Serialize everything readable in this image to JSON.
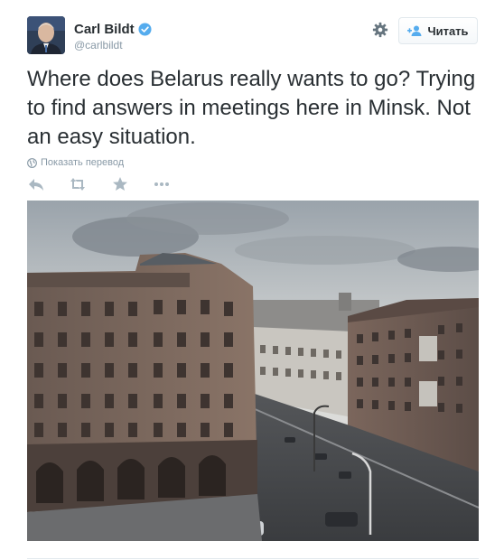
{
  "tweet": {
    "author_name": "Carl Bildt",
    "handle": "@carlbildt",
    "text": "Where does Belarus really wants to go? Trying to find answers in meetings here in Minsk. Not an easy situation.",
    "translate_label": "Показать перевод"
  },
  "header": {
    "follow_label": "Читать"
  },
  "icons": {
    "verified": "verified-badge-icon",
    "settings": "gear-icon",
    "follow": "add-user-icon",
    "translate": "globe-icon",
    "reply": "reply-icon",
    "retweet": "retweet-icon",
    "favorite": "star-icon",
    "more": "more-icon"
  },
  "colors": {
    "verified_blue": "#55acee",
    "muted_text": "#8899a6",
    "action_icon": "#aab8c2"
  }
}
